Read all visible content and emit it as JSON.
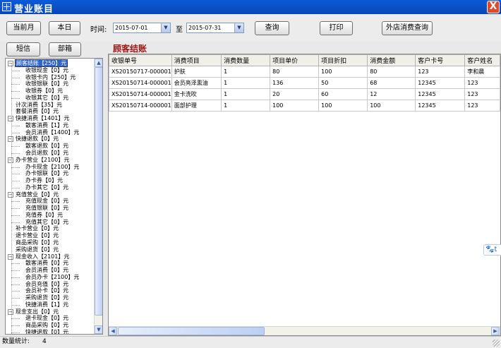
{
  "window": {
    "title": "营业账目",
    "close_glyph": "X"
  },
  "toolbar": {
    "current_month": "当前月",
    "today": "本日",
    "time_label": "时间:",
    "date_from": "2015-07-01",
    "to_label": "至",
    "date_to": "2015-07-31",
    "query": "查询",
    "print": "打印",
    "external_query": "外店消费查询"
  },
  "leftbar": {
    "sms": "短信",
    "department": "部箱"
  },
  "tree": [
    {
      "text": "顾客结账【250】元",
      "level": 0,
      "expander": "−",
      "selected": true
    },
    {
      "text": "收银现金【0】元",
      "level": 1
    },
    {
      "text": "收银卡内【250】元",
      "level": 1
    },
    {
      "text": "收银银联【0】元",
      "level": 1
    },
    {
      "text": "收银券【0】元",
      "level": 1
    },
    {
      "text": "收银其它【0】元",
      "level": 1
    },
    {
      "text": "计次消费【35】元",
      "level": 0
    },
    {
      "text": "套餐消费【0】元",
      "level": 0
    },
    {
      "text": "快捷消费【1401】元",
      "level": 0,
      "expander": "−"
    },
    {
      "text": "散客消费【1】元",
      "level": 1
    },
    {
      "text": "会员消费【1400】元",
      "level": 1
    },
    {
      "text": "快捷退款【0】元",
      "level": 0,
      "expander": "−"
    },
    {
      "text": "散客退款【0】元",
      "level": 1
    },
    {
      "text": "会员退款【0】元",
      "level": 1
    },
    {
      "text": "办卡营业【2100】元",
      "level": 0,
      "expander": "−"
    },
    {
      "text": "办卡现金【2100】元",
      "level": 1
    },
    {
      "text": "办卡银联【0】元",
      "level": 1
    },
    {
      "text": "办卡券【0】元",
      "level": 1
    },
    {
      "text": "办卡其它【0】元",
      "level": 1
    },
    {
      "text": "充值营业【0】元",
      "level": 0,
      "expander": "−"
    },
    {
      "text": "充值现金【0】元",
      "level": 1
    },
    {
      "text": "充值银联【0】元",
      "level": 1
    },
    {
      "text": "充值券【0】元",
      "level": 1
    },
    {
      "text": "充值其它【0】元",
      "level": 1
    },
    {
      "text": "补卡营业【0】元",
      "level": 0
    },
    {
      "text": "退卡营业【0】元",
      "level": 0
    },
    {
      "text": "商品采购【0】元",
      "level": 0
    },
    {
      "text": "采购退货【0】元",
      "level": 0
    },
    {
      "text": "现金收入【2101】元",
      "level": 0,
      "expander": "−"
    },
    {
      "text": "散客消费【0】元",
      "level": 1
    },
    {
      "text": "会员消费【0】元",
      "level": 1
    },
    {
      "text": "会员办卡【2100】元",
      "level": 1
    },
    {
      "text": "会员充值【0】元",
      "level": 1
    },
    {
      "text": "会员补卡【0】元",
      "level": 1
    },
    {
      "text": "采购退货【0】元",
      "level": 1
    },
    {
      "text": "快捷消费【1】元",
      "level": 1
    },
    {
      "text": "现金支出【0】元",
      "level": 0,
      "expander": "−"
    },
    {
      "text": "退卡现金【0】元",
      "level": 1
    },
    {
      "text": "商品采购【0】元",
      "level": 1
    },
    {
      "text": "快捷退款【0】元",
      "level": 1
    }
  ],
  "section_title": "顾客结账",
  "table": {
    "columns": [
      "收银单号",
      "消费项目",
      "消费数量",
      "项目单价",
      "项目折扣",
      "消费金额",
      "客户卡号",
      "客户姓名"
    ],
    "rows": [
      [
        "XS20150717-000001",
        "护肤",
        "1",
        "80",
        "100",
        "80",
        "123",
        "李和晨"
      ],
      [
        "XS20150714-000001",
        "会员亮泽熏油",
        "1",
        "136",
        "50",
        "68",
        "12345",
        "123"
      ],
      [
        "XS20150714-000001",
        "金卡洗吹",
        "1",
        "20",
        "60",
        "12",
        "12345",
        "123"
      ],
      [
        "XS20150714-000001",
        "面部护理",
        "1",
        "100",
        "100",
        "100",
        "12345",
        "123"
      ]
    ]
  },
  "side_tab": {
    "icon": "paw-icon",
    "glyph": "🐾",
    "text": "t"
  },
  "status": {
    "label": "数量统计:",
    "count": "4"
  }
}
